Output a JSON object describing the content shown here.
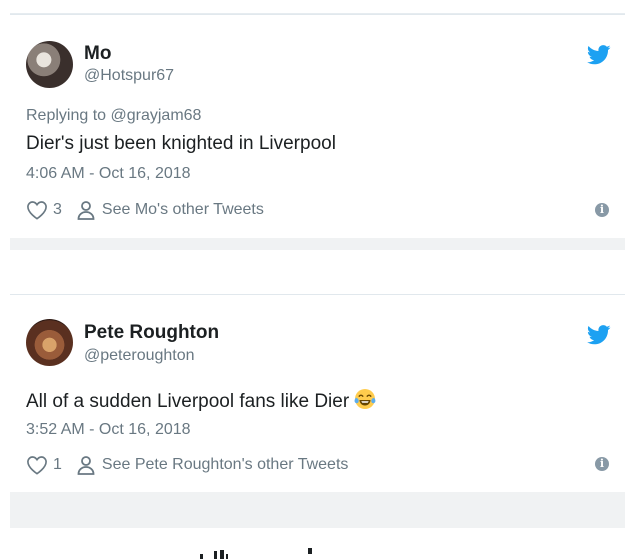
{
  "colors": {
    "text": "#1c2022",
    "muted": "#697882",
    "twitter_blue": "#1da1f2",
    "divider": "#f0f2f3"
  },
  "tweets": [
    {
      "name": "Mo",
      "handle": "@Hotspur67",
      "replying_to": "Replying to @grayjam68",
      "text": "Dier's just been knighted in Liverpool",
      "emoji": "",
      "timestamp": "4:06 AM - Oct 16, 2018",
      "likes": "3",
      "other_link": "See Mo's other Tweets",
      "icons": [
        "avatar",
        "twitter-bird-icon",
        "heart-icon",
        "person-icon",
        "info-icon"
      ]
    },
    {
      "name": "Pete Roughton",
      "handle": "@peteroughton",
      "replying_to": "",
      "text": "All of a sudden Liverpool fans like Dier",
      "emoji": "face-with-tears-of-joy",
      "timestamp": "3:52 AM - Oct 16, 2018",
      "likes": "1",
      "other_link": "See Pete Roughton's other Tweets",
      "icons": [
        "avatar",
        "twitter-bird-icon",
        "heart-icon",
        "person-icon",
        "info-icon"
      ]
    }
  ]
}
